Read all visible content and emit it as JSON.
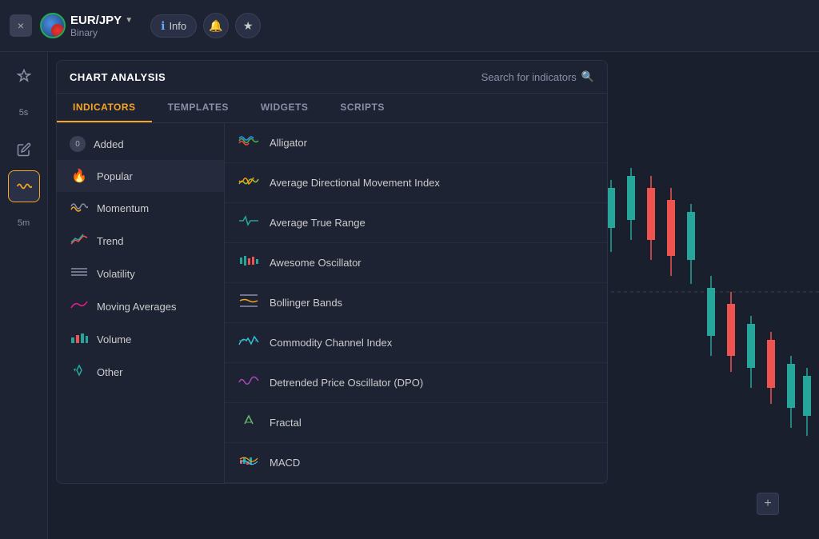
{
  "topBar": {
    "closeLabel": "×",
    "currencyPair": "EUR/JPY",
    "currencyType": "Binary",
    "chevron": "▼",
    "infoLabel": "Info",
    "pinLabel": "✦"
  },
  "sidebar": {
    "items": [
      {
        "label": "pin",
        "icon": "✦",
        "active": false
      },
      {
        "label": "5s",
        "icon": "5s",
        "active": false
      },
      {
        "label": "edit",
        "icon": "✎",
        "active": false
      },
      {
        "label": "wave",
        "icon": "〜",
        "active": true
      },
      {
        "label": "5m",
        "icon": "5m",
        "active": false
      }
    ]
  },
  "panel": {
    "title": "CHART ANALYSIS",
    "searchPlaceholder": "Search for indicators",
    "tabs": [
      {
        "label": "INDICATORS",
        "active": true
      },
      {
        "label": "TEMPLATES",
        "active": false
      },
      {
        "label": "WIDGETS",
        "active": false
      },
      {
        "label": "SCRIPTS",
        "active": false
      }
    ],
    "categories": [
      {
        "label": "Added",
        "icon": "badge",
        "badge": "0",
        "active": false
      },
      {
        "label": "Popular",
        "icon": "fire",
        "active": true
      },
      {
        "label": "Momentum",
        "icon": "waves",
        "active": false
      },
      {
        "label": "Trend",
        "icon": "trend",
        "active": false
      },
      {
        "label": "Volatility",
        "icon": "vol",
        "active": false
      },
      {
        "label": "Moving Averages",
        "icon": "ma",
        "active": false
      },
      {
        "label": "Volume",
        "icon": "volume",
        "active": false
      },
      {
        "label": "Other",
        "icon": "other",
        "active": false
      }
    ],
    "indicators": [
      {
        "label": "Alligator",
        "icon": "alligator"
      },
      {
        "label": "Average Directional Movement Index",
        "icon": "admi"
      },
      {
        "label": "Average True Range",
        "icon": "atr"
      },
      {
        "label": "Awesome Oscillator",
        "icon": "ao"
      },
      {
        "label": "Bollinger Bands",
        "icon": "bb"
      },
      {
        "label": "Commodity Channel Index",
        "icon": "cci"
      },
      {
        "label": "Detrended Price Oscillator (DPO)",
        "icon": "dpo"
      },
      {
        "label": "Fractal",
        "icon": "fractal"
      },
      {
        "label": "MACD",
        "icon": "macd"
      }
    ]
  }
}
